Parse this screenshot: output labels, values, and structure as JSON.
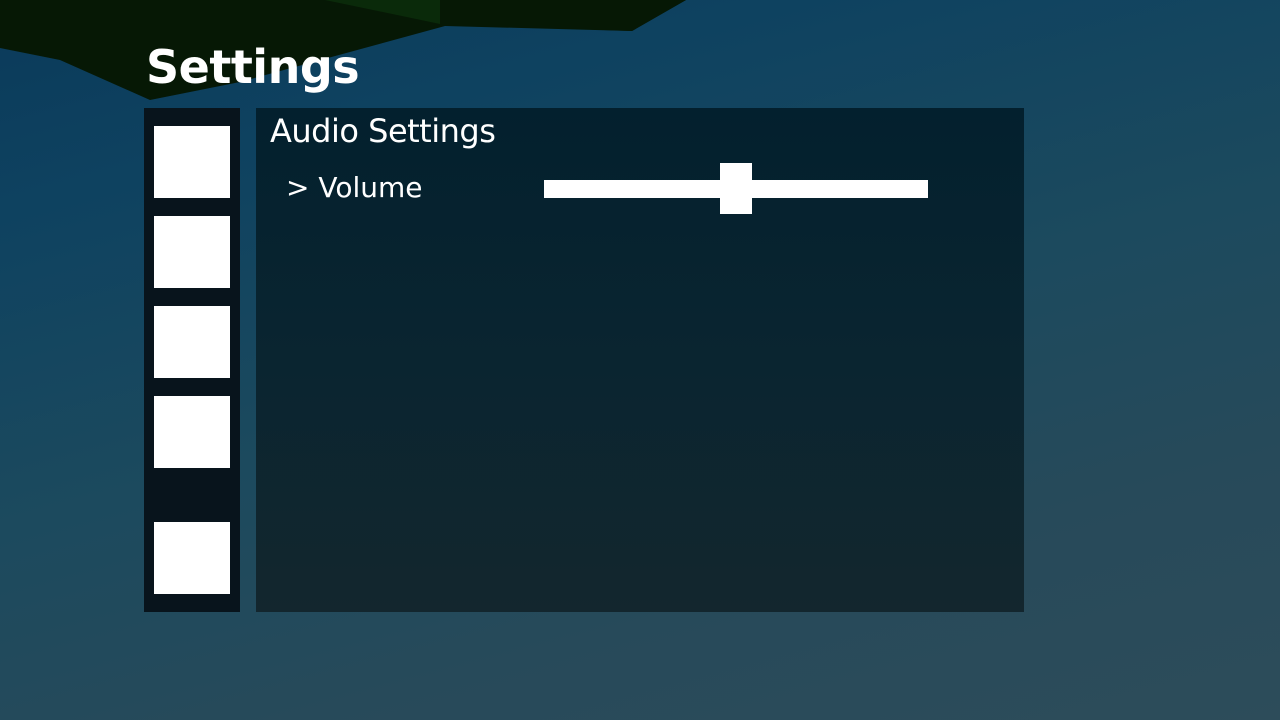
{
  "title": "Settings",
  "sidebar": {
    "tabs": [
      {
        "name": "tab-1"
      },
      {
        "name": "tab-2"
      },
      {
        "name": "tab-3"
      },
      {
        "name": "tab-4"
      },
      {
        "name": "tab-5"
      }
    ]
  },
  "main": {
    "section_title": "Audio Settings",
    "settings": [
      {
        "label": "> Volume",
        "type": "slider",
        "value": 0.5
      }
    ]
  },
  "colors": {
    "text": "#ffffff",
    "panel": "#0a2530",
    "sidebar": "#08141c",
    "foliage": "#071905"
  }
}
